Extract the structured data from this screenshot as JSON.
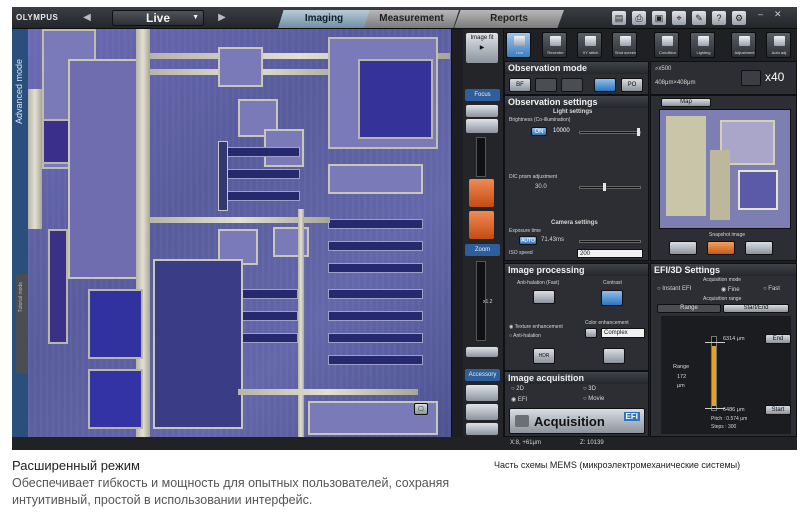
{
  "app": {
    "logo": "OLYMPUS",
    "mode_selector": "Live",
    "tabs": [
      {
        "label": "Imaging",
        "active": true
      },
      {
        "label": "Measurement",
        "active": false
      },
      {
        "label": "Reports",
        "active": false
      }
    ],
    "side_mode_label": "Advanced mode",
    "side_tab_label": "Tutorial mode"
  },
  "toolbar": {
    "icons": [
      "export-icon",
      "print-icon",
      "save-icon",
      "microscope-icon",
      "tools-icon",
      "help-icon",
      "wrench-icon"
    ]
  },
  "tool_column": {
    "image_fit_label": "Image fit",
    "focus_label": "Focus",
    "zoom_label": "Zoom",
    "zoom_value": "x1.2",
    "accessory_label": "Accessory"
  },
  "icon_strip": [
    {
      "label": "Live",
      "selected": true
    },
    {
      "label": "Recentre",
      "selected": false
    },
    {
      "label": "XY stitch",
      "selected": false
    },
    {
      "label": "Shot screen",
      "selected": false
    },
    {
      "label": "Condition",
      "selected": false
    },
    {
      "label": "Lighting",
      "selected": false
    },
    {
      "label": "Adjustment",
      "selected": false
    },
    {
      "label": "Auto adj.",
      "selected": false
    }
  ],
  "observation_mode": {
    "title": "Observation mode",
    "buttons": [
      "BF",
      "",
      "",
      "",
      "PO"
    ],
    "zoom_text": "x500",
    "field_text": "408μm×408μm",
    "magnification": "x40"
  },
  "observation_settings": {
    "title": "Observation settings",
    "light_title": "Light settings",
    "brightness_label": "Brightness (Co-illumination)",
    "on_label": "ON",
    "brightness_value": "10000",
    "dic_label": "DIC prism adjustment",
    "dic_value": "30.0",
    "camera_title": "Camera settings",
    "exposure_label": "Exposure time",
    "auto_label": "AUTO",
    "exposure_value": "71.43ms",
    "iso_label": "ISO speed",
    "iso_value": "200"
  },
  "map": {
    "tab_label": "Map",
    "snapshot_label": "Snapshot image"
  },
  "image_processing": {
    "title": "Image processing",
    "anti_halation": "Anti-halation (Fast)",
    "contrast": "Contrast",
    "texture": "Texture enhancement",
    "anti_halation2": "Anti-halation",
    "color_enhancement": "Color enhancement",
    "hdr": "HDR",
    "color_value": "Complex"
  },
  "image_acquisition": {
    "title": "Image acquisition",
    "options": [
      "2D",
      "3D",
      "EFI",
      "Movie"
    ],
    "button_label": "Acquisition",
    "button_badge": "EFI"
  },
  "efi_settings": {
    "title": "EFI/3D Settings",
    "acq_mode_label": "Acquisition mode",
    "modes": [
      "Instant EFI",
      "Fine",
      "Fast"
    ],
    "acq_range_label": "Acquisition range",
    "range_tabs": [
      "Range",
      "Start/End"
    ],
    "top_value": "6314",
    "top_unit": "μm",
    "top_button": "End",
    "range_label": "Range",
    "range_value": "172",
    "range_unit": "μm",
    "bottom_value": "6486",
    "bottom_unit": "μm",
    "bottom_button": "Start",
    "pitch": "Pitch : 0.574 μm",
    "steps": "Steps : 300"
  },
  "status": {
    "xy": "X:8, +61μm",
    "z": "Z:    10139"
  },
  "caption": {
    "title": "Расширенный режим",
    "body": "Обеспечивает гибкость и мощность для опытных пользователей, сохраняя интуитивный, простой в использовании интерфейс.",
    "right": "Часть схемы MEMS (микроэлектромеханические системы)"
  }
}
